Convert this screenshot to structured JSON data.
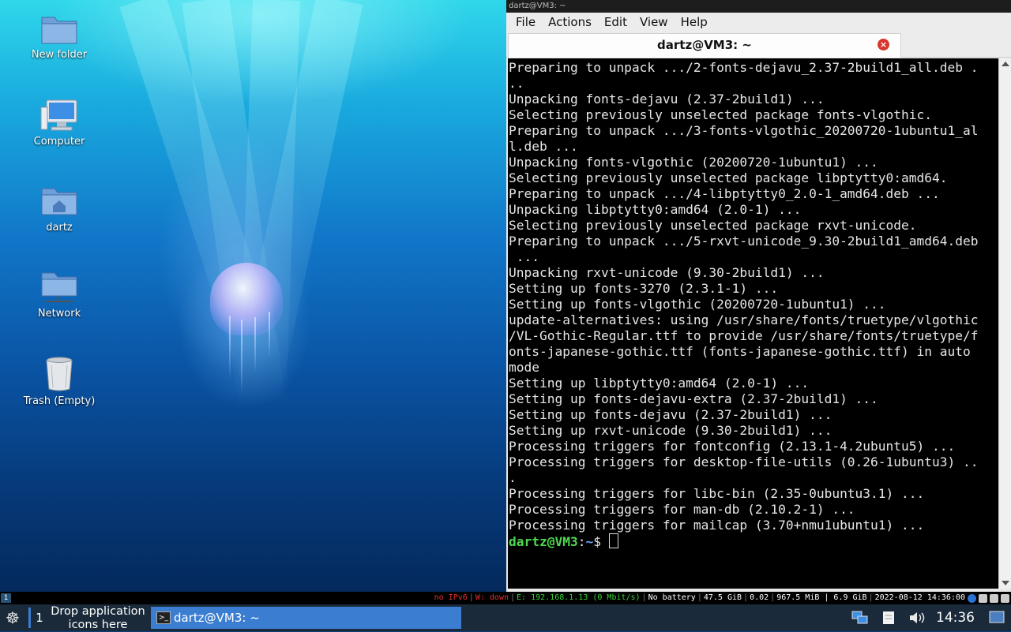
{
  "desktop": {
    "icons": [
      {
        "label": "New folder",
        "icon": "folder-icon"
      },
      {
        "label": "Computer",
        "icon": "computer-icon"
      },
      {
        "label": "dartz",
        "icon": "home-folder-icon"
      },
      {
        "label": "Network",
        "icon": "network-folder-icon"
      },
      {
        "label": "Trash (Empty)",
        "icon": "trash-icon"
      }
    ]
  },
  "window": {
    "outer_title": "dartz@VM3: ~",
    "menu": [
      "File",
      "Actions",
      "Edit",
      "View",
      "Help"
    ],
    "tab_title": "dartz@VM3: ~",
    "close_glyph": "×"
  },
  "terminal": {
    "lines": [
      "Preparing to unpack .../2-fonts-dejavu_2.37-2build1_all.deb .",
      "..",
      "Unpacking fonts-dejavu (2.37-2build1) ...",
      "Selecting previously unselected package fonts-vlgothic.",
      "Preparing to unpack .../3-fonts-vlgothic_20200720-1ubuntu1_al",
      "l.deb ...",
      "Unpacking fonts-vlgothic (20200720-1ubuntu1) ...",
      "Selecting previously unselected package libptytty0:amd64.",
      "Preparing to unpack .../4-libptytty0_2.0-1_amd64.deb ...",
      "Unpacking libptytty0:amd64 (2.0-1) ...",
      "Selecting previously unselected package rxvt-unicode.",
      "Preparing to unpack .../5-rxvt-unicode_9.30-2build1_amd64.deb",
      " ...",
      "Unpacking rxvt-unicode (9.30-2build1) ...",
      "Setting up fonts-3270 (2.3.1-1) ...",
      "Setting up fonts-vlgothic (20200720-1ubuntu1) ...",
      "update-alternatives: using /usr/share/fonts/truetype/vlgothic",
      "/VL-Gothic-Regular.ttf to provide /usr/share/fonts/truetype/f",
      "onts-japanese-gothic.ttf (fonts-japanese-gothic.ttf) in auto",
      "mode",
      "Setting up libptytty0:amd64 (2.0-1) ...",
      "Setting up fonts-dejavu-extra (2.37-2build1) ...",
      "Setting up fonts-dejavu (2.37-2build1) ...",
      "Setting up rxvt-unicode (9.30-2build1) ...",
      "Processing triggers for fontconfig (2.13.1-4.2ubuntu5) ...",
      "Processing triggers for desktop-file-utils (0.26-1ubuntu3) ..",
      ".",
      "Processing triggers for libc-bin (2.35-0ubuntu3.1) ...",
      "Processing triggers for man-db (2.10.2-1) ...",
      "Processing triggers for mailcap (3.70+nmu1ubuntu1) ..."
    ],
    "prompt_user": "dartz@VM3",
    "prompt_sep": ":",
    "prompt_path": "~",
    "prompt_symbol": "$ "
  },
  "statusbar": {
    "workspace": "1",
    "items": [
      {
        "text": "no IPv6",
        "color": "#e03030"
      },
      {
        "text": "W: down",
        "color": "#e03030"
      },
      {
        "text": "E: 192.168.1.13 (0 Mbit/s)",
        "color": "#33d633"
      },
      {
        "text": "No battery",
        "color": "#ffffff"
      },
      {
        "text": "47.5 GiB",
        "color": "#ffffff"
      },
      {
        "text": "0.02",
        "color": "#ffffff"
      },
      {
        "text": "967.5 MiB | 6.9 GiB",
        "color": "#ffffff"
      },
      {
        "text": "2022-08-12 14:36:00",
        "color": "#ffffff"
      }
    ]
  },
  "taskbar": {
    "workspace_number": "1",
    "launcher_text_line1": "Drop application",
    "launcher_text_line2": "icons here",
    "task_label": "dartz@VM3: ~",
    "clock": "14:36"
  },
  "colors": {
    "accent": "#3b7ed1",
    "taskbar_bg": "#1a2a3a",
    "close_button": "#d8362c"
  }
}
